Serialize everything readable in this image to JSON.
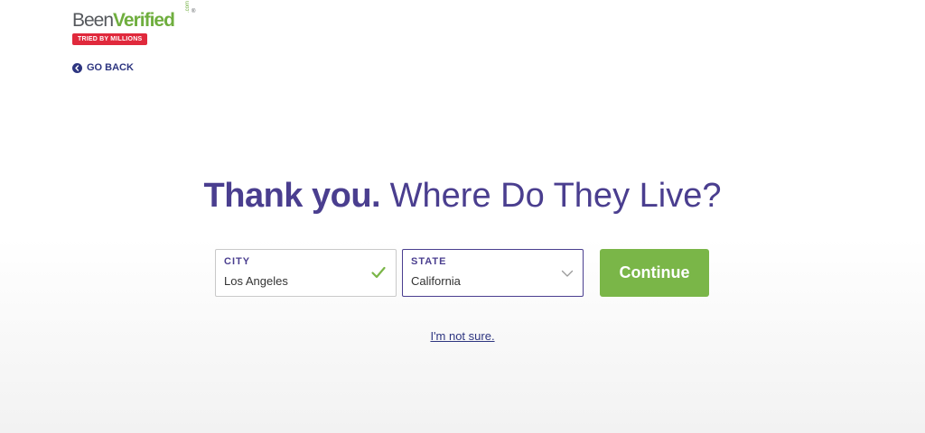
{
  "brand": {
    "name_part1": "Been",
    "name_part2": "Verified",
    "name_suffix": ".com",
    "registered_mark": "®",
    "tagline": "TRIED BY MILLIONS",
    "colors": {
      "gray": "#55585c",
      "green": "#6fae3e",
      "red": "#e0293c"
    }
  },
  "nav": {
    "back_label": "GO BACK",
    "back_icon": "chevron-left-circle-icon"
  },
  "heading": {
    "strong": "Thank you.",
    "rest": "Where Do They Live?"
  },
  "form": {
    "city": {
      "label": "CITY",
      "value": "Los Angeles",
      "valid_icon": "check-icon"
    },
    "state": {
      "label": "STATE",
      "value": "California",
      "dropdown_icon": "chevron-down-icon"
    },
    "submit_label": "Continue"
  },
  "links": {
    "not_sure": "I'm not sure."
  },
  "colors": {
    "primary": "#4a3e8f",
    "link": "#2d3580",
    "button": "#7ab648",
    "check": "#7ab648"
  }
}
